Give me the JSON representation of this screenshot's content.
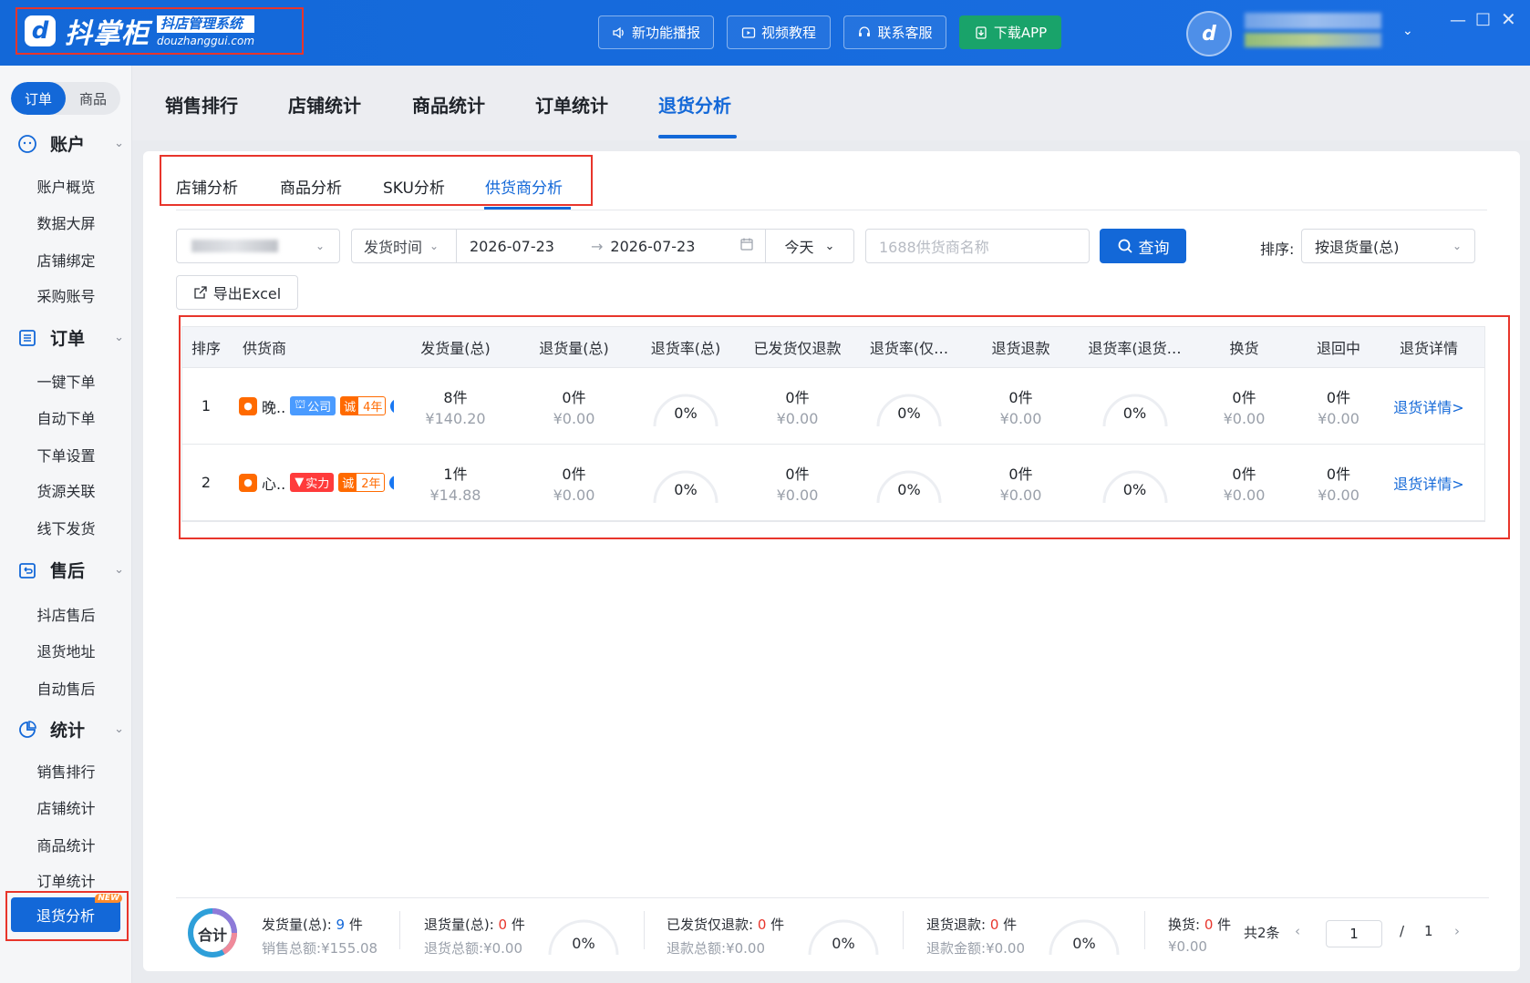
{
  "app": {
    "brand_name": "抖掌柜",
    "brand_tagline": "抖店管理系统",
    "brand_domain": "douzhanggui.com",
    "header_buttons": [
      "新功能播报",
      "视频教程",
      "联系客服",
      "下载APP"
    ]
  },
  "sidebar": {
    "segments": [
      "订单",
      "商品"
    ],
    "groups": [
      {
        "label": "账户",
        "items": [
          "账户概览",
          "数据大屏",
          "店铺绑定",
          "采购账号"
        ]
      },
      {
        "label": "订单",
        "items": [
          "一键下单",
          "自动下单",
          "下单设置",
          "货源关联",
          "线下发货"
        ]
      },
      {
        "label": "售后",
        "items": [
          "抖店售后",
          "退货地址",
          "自动售后"
        ]
      },
      {
        "label": "统计",
        "items": [
          "销售排行",
          "店铺统计",
          "商品统计",
          "订单统计",
          "退货分析"
        ]
      }
    ],
    "active_item": "退货分析",
    "new_tag": "NEW"
  },
  "top_tabs": [
    "销售排行",
    "店铺统计",
    "商品统计",
    "订单统计",
    "退货分析"
  ],
  "sub_tabs": [
    "店铺分析",
    "商品分析",
    "SKU分析",
    "供货商分析"
  ],
  "filters": {
    "date_type": "发货时间",
    "date_start": "2026-07-23",
    "date_end": "2026-07-23",
    "quick_range": "今天",
    "supplier_placeholder": "1688供货商名称",
    "query_button": "查询",
    "sort_label": "排序:",
    "sort_value": "按退货量(总)",
    "export_button": "导出Excel"
  },
  "table": {
    "headers": [
      "排序",
      "供货商",
      "发货量(总)",
      "退货量(总)",
      "退货率(总)",
      "已发货仅退款",
      "退货率(仅…",
      "退货退款",
      "退货率(退货…",
      "换货",
      "退回中",
      "退货详情"
    ],
    "rows": [
      {
        "rank": "1",
        "supplier": "晚..",
        "badge_type": "公司",
        "years": "4年",
        "shipped": "8件",
        "shipped_amt": "¥140.20",
        "returned": "0件",
        "returned_amt": "¥0.00",
        "rate_total": "0%",
        "refund_only": "0件",
        "refund_only_amt": "¥0.00",
        "rate_refund": "0%",
        "return_refund": "0件",
        "return_refund_amt": "¥0.00",
        "rate_return": "0%",
        "exchange": "0件",
        "exchange_amt": "¥0.00",
        "returning": "0件",
        "returning_amt": "¥0.00",
        "detail": "退货详情>"
      },
      {
        "rank": "2",
        "supplier": "心..",
        "badge_type": "实力",
        "years": "2年",
        "shipped": "1件",
        "shipped_amt": "¥14.88",
        "returned": "0件",
        "returned_amt": "¥0.00",
        "rate_total": "0%",
        "refund_only": "0件",
        "refund_only_amt": "¥0.00",
        "rate_refund": "0%",
        "return_refund": "0件",
        "return_refund_amt": "¥0.00",
        "rate_return": "0%",
        "exchange": "0件",
        "exchange_amt": "¥0.00",
        "returning": "0件",
        "returning_amt": "¥0.00",
        "detail": "退货详情>"
      }
    ],
    "badge_prefix": "诚",
    "supplier_icon_text": "1688"
  },
  "summary": {
    "total_label": "合计",
    "shipped_label": "发货量(总):",
    "shipped_value": "9",
    "shipped_unit": "件",
    "sales_label": "销售总额:",
    "sales_value": "¥155.08",
    "returned_label": "退货量(总):",
    "returned_value": "0",
    "returned_unit": "件",
    "returned_amt_label": "退货总额:",
    "returned_amt_value": "¥0.00",
    "rate1": "0%",
    "refund_only_label": "已发货仅退款:",
    "refund_only_value": "0",
    "refund_only_unit": "件",
    "refund_amt_label": "退款总额:",
    "refund_amt_value": "¥0.00",
    "rate2": "0%",
    "return_refund_label": "退货退款:",
    "return_refund_value": "0",
    "return_refund_unit": "件",
    "return_amt_label": "退款金额:",
    "return_amt_value": "¥0.00",
    "rate3": "0%",
    "exchange_label": "换货:",
    "exchange_value": "0",
    "exchange_unit": "件",
    "exchange_amt": "¥0.00",
    "total_count": "共2条",
    "page": "1",
    "page_sep": "/",
    "page_total": "1"
  },
  "colors": {
    "primary": "#1368d8",
    "highlight_border": "#e8352b",
    "danger": "#e8352b",
    "download": "#19a36a"
  }
}
